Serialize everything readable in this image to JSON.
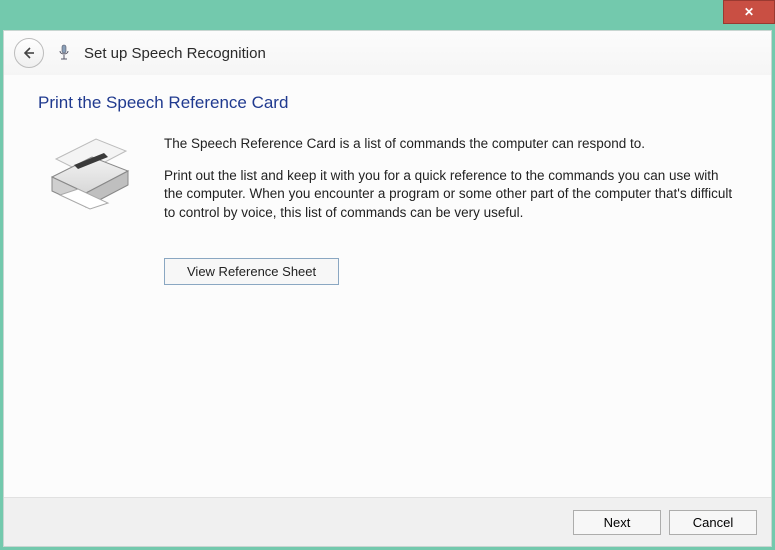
{
  "titlebar": {
    "close_glyph": "✕"
  },
  "wizard": {
    "title": "Set up Speech Recognition"
  },
  "page": {
    "heading": "Print the Speech Reference Card",
    "para1": "The Speech Reference Card is a list of commands the computer can respond to.",
    "para2": "Print out the list and keep it with you for a quick reference to the commands you can use with the computer. When you encounter a program or some other part of the computer that's difficult to control by voice, this list of commands can be very useful.",
    "view_button": "View Reference Sheet"
  },
  "footer": {
    "next": "Next",
    "cancel": "Cancel"
  }
}
